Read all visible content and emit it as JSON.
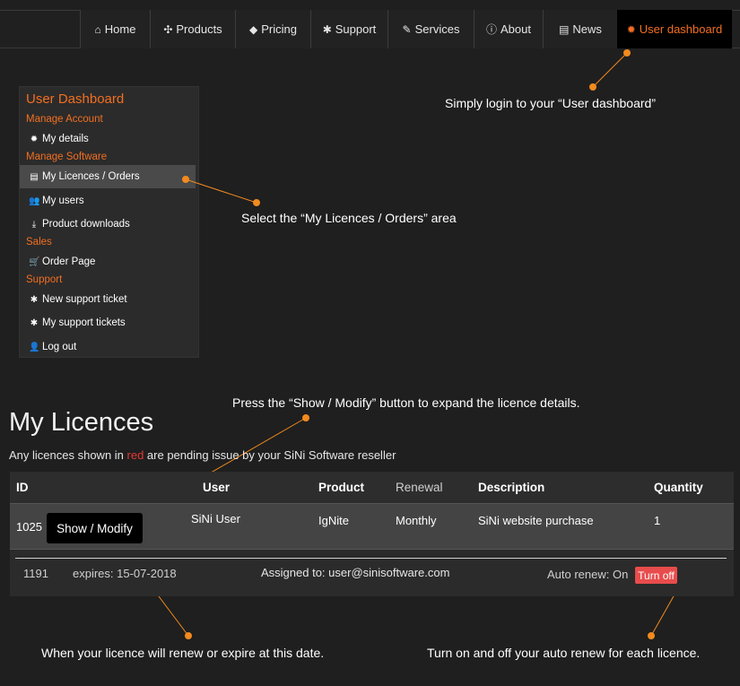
{
  "nav": {
    "items": [
      {
        "label": "Home",
        "icon": "home-icon",
        "glyph": "⌂"
      },
      {
        "label": "Products",
        "icon": "puzzle-icon",
        "glyph": "✣"
      },
      {
        "label": "Pricing",
        "icon": "tag-icon",
        "glyph": "◆"
      },
      {
        "label": "Support",
        "icon": "bug-icon",
        "glyph": "✱"
      },
      {
        "label": "Services",
        "icon": "wrench-icon",
        "glyph": "✎"
      },
      {
        "label": "About",
        "icon": "info-icon",
        "glyph": "ⓘ"
      },
      {
        "label": "News",
        "icon": "newspaper-icon",
        "glyph": "▤"
      },
      {
        "label": "User dashboard",
        "icon": "gear-icon",
        "glyph": "✹"
      }
    ],
    "active": "User dashboard"
  },
  "sidebar": {
    "title": "User Dashboard",
    "sections": {
      "manage_account": "Manage Account",
      "manage_software": "Manage Software",
      "sales": "Sales",
      "support": "Support"
    },
    "items": {
      "my_details": "My details",
      "my_licences": "My Licences / Orders",
      "my_users": "My users",
      "product_downloads": "Product downloads",
      "order_page": "Order Page",
      "new_ticket": "New support ticket",
      "my_tickets": "My support tickets",
      "log_out": "Log out"
    }
  },
  "callouts": {
    "login": "Simply login to your “User dashboard”",
    "select": "Select the “My Licences / Orders” area",
    "press": "Press the “Show / Modify” button to expand the licence details.",
    "renew_date": "When your licence will renew or expire at this date.",
    "auto_renew": "Turn on and off your auto renew for each licence."
  },
  "licences": {
    "title": "My Licences",
    "subtitle_before": "Any licences shown in ",
    "subtitle_red": "red",
    "subtitle_after": " are pending issue by your SiNi Software reseller",
    "columns": {
      "id": "ID",
      "user": "User",
      "product": "Product",
      "renewal": "Renewal",
      "description": "Description",
      "quantity": "Quantity"
    },
    "row": {
      "id": "1025",
      "show_button": "Show / Modify",
      "user": "SiNi User",
      "product": "IgNite",
      "renewal": "Monthly",
      "description": "SiNi website purchase",
      "quantity": "1"
    },
    "detail": {
      "id": "1191",
      "expires": "expires: 15-07-2018",
      "assigned": "Assigned to: user@sinisoftware.com",
      "auto_renew": "Auto renew: On",
      "turn_off_button": "Turn off"
    }
  },
  "colors": {
    "accent": "#f26f21",
    "pending": "#e53935",
    "turn_off": "#e84c4c"
  }
}
